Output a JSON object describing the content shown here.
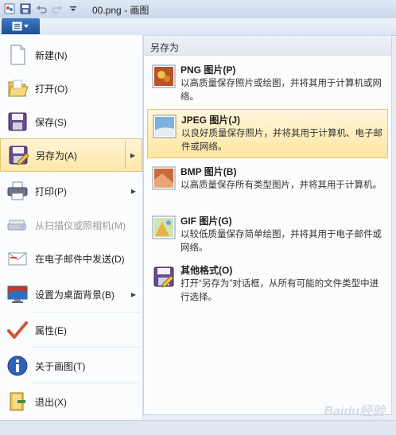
{
  "window": {
    "title": "00.png - 画图"
  },
  "quick_access": [
    "paint-app-icon",
    "save-icon",
    "undo-icon",
    "redo-icon",
    "customize-icon"
  ],
  "app_menu_button": {
    "icon": "app-menu-icon"
  },
  "left_menu": {
    "items": [
      {
        "label": "新建(N)",
        "icon": "new-file-icon",
        "has_arrow": false
      },
      {
        "label": "打开(O)",
        "icon": "open-folder-icon",
        "has_arrow": false
      },
      {
        "label": "保存(S)",
        "icon": "save-disk-icon",
        "has_arrow": false
      },
      {
        "label": "另存为(A)",
        "icon": "save-as-icon",
        "has_arrow": true,
        "selected": true
      },
      {
        "label": "打印(P)",
        "icon": "printer-icon",
        "has_arrow": true
      },
      {
        "label": "从扫描仪或照相机(M)",
        "icon": "scanner-icon",
        "has_arrow": false,
        "disabled": true
      },
      {
        "label": "在电子邮件中发送(D)",
        "icon": "email-icon",
        "has_arrow": false
      },
      {
        "label": "设置为桌面背景(B)",
        "icon": "desktop-background-icon",
        "has_arrow": true
      },
      {
        "label": "属性(E)",
        "icon": "properties-check-icon",
        "has_arrow": false
      },
      {
        "label": "关于画图(T)",
        "icon": "info-icon",
        "has_arrow": false
      },
      {
        "label": "退出(X)",
        "icon": "exit-icon",
        "has_arrow": false
      }
    ]
  },
  "save_as_menu": {
    "header": "另存为",
    "items": [
      {
        "title": "PNG 图片(P)",
        "desc": "以高质量保存照片或绘图，并将其用于计算机或网络。",
        "icon": "png-image-icon"
      },
      {
        "title": "JPEG 图片(J)",
        "desc": "以良好质量保存照片，并将其用于计算机、电子邮件或网络。",
        "icon": "jpeg-image-icon",
        "selected": true
      },
      {
        "title": "BMP 图片(B)",
        "desc": "以高质量保存所有类型图片，并将其用于计算机。",
        "icon": "bmp-image-icon"
      },
      {
        "title": "GIF 图片(G)",
        "desc": "以较低质量保存简单绘图，并将其用于电子邮件或网络。",
        "icon": "gif-image-icon"
      },
      {
        "title": "其他格式(O)",
        "desc": "打开“另存为”对话框，从所有可能的文件类型中进行选择。",
        "icon": "other-formats-icon"
      }
    ]
  },
  "watermark": "Baidu经验",
  "colors": {
    "highlight": "#ffe7a8",
    "highlight_border": "#e7c56c",
    "app_button": "#1f4f96"
  }
}
